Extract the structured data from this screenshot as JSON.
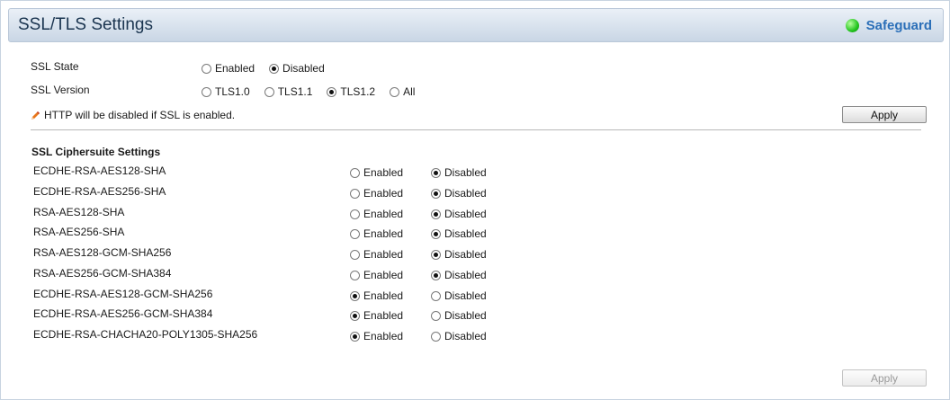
{
  "header": {
    "title": "SSL/TLS Settings",
    "safeguard_label": "Safeguard"
  },
  "ssl_state": {
    "label": "SSL State",
    "options": [
      "Enabled",
      "Disabled"
    ],
    "selected": "Disabled"
  },
  "ssl_version": {
    "label": "SSL Version",
    "options": [
      "TLS1.0",
      "TLS1.1",
      "TLS1.2",
      "All"
    ],
    "selected": "TLS1.2"
  },
  "note": {
    "icon": "pencil-icon",
    "text": "HTTP will be disabled if SSL is enabled."
  },
  "apply_top_label": "Apply",
  "ciphersuite": {
    "title": "SSL Ciphersuite Settings",
    "option_enabled": "Enabled",
    "option_disabled": "Disabled",
    "rows": [
      {
        "name": "ECDHE-RSA-AES128-SHA",
        "value": "Disabled"
      },
      {
        "name": "ECDHE-RSA-AES256-SHA",
        "value": "Disabled"
      },
      {
        "name": "RSA-AES128-SHA",
        "value": "Disabled"
      },
      {
        "name": "RSA-AES256-SHA",
        "value": "Disabled"
      },
      {
        "name": "RSA-AES128-GCM-SHA256",
        "value": "Disabled"
      },
      {
        "name": "RSA-AES256-GCM-SHA384",
        "value": "Disabled"
      },
      {
        "name": "ECDHE-RSA-AES128-GCM-SHA256",
        "value": "Enabled"
      },
      {
        "name": "ECDHE-RSA-AES256-GCM-SHA384",
        "value": "Enabled"
      },
      {
        "name": "ECDHE-RSA-CHACHA20-POLY1305-SHA256",
        "value": "Enabled"
      }
    ]
  },
  "apply_bottom_label": "Apply",
  "colors": {
    "header_text": "#1b3550",
    "safeguard_text": "#2b6fb8",
    "safeguard_led": "#22c41e"
  }
}
